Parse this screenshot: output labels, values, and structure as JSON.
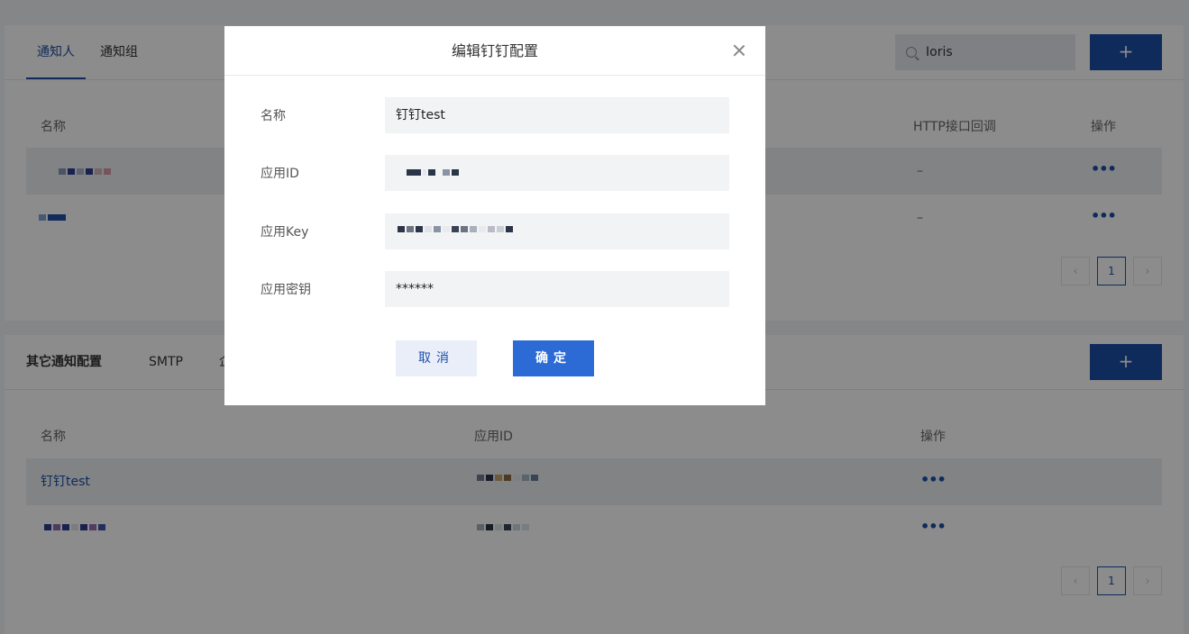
{
  "tabs": [
    {
      "label": "通知人"
    },
    {
      "label": "通知组"
    }
  ],
  "search": {
    "value": "Ioris"
  },
  "add_label": "+",
  "table1": {
    "headers": {
      "name": "名称",
      "http": "HTTP接口回调",
      "ops": "操作"
    },
    "rows": [
      {
        "http": "–",
        "ops": "•••"
      },
      {
        "http": "–",
        "ops": "•••"
      }
    ]
  },
  "pagination": {
    "prev": "‹",
    "page": "1",
    "next": "›"
  },
  "section2": {
    "title": "其它通知配置",
    "smtp": "SMTP",
    "more": "企"
  },
  "table2": {
    "headers": {
      "name": "名称",
      "appid": "应用ID",
      "ops": "操作"
    },
    "rows": [
      {
        "name": "钉钉test",
        "ops": "•••"
      },
      {
        "name": "",
        "ops": "•••"
      }
    ]
  },
  "modal": {
    "title": "编辑钉钉配置",
    "fields": [
      {
        "label": "名称",
        "value": "钉钉test"
      },
      {
        "label": "应用ID",
        "value": ""
      },
      {
        "label": "应用Key",
        "value": ""
      },
      {
        "label": "应用密钥",
        "value": "******"
      }
    ],
    "cancel": "取消",
    "confirm": "确定"
  },
  "colors": {
    "accent": "#1d4fa8",
    "primary_button": "#2c6bd6"
  }
}
